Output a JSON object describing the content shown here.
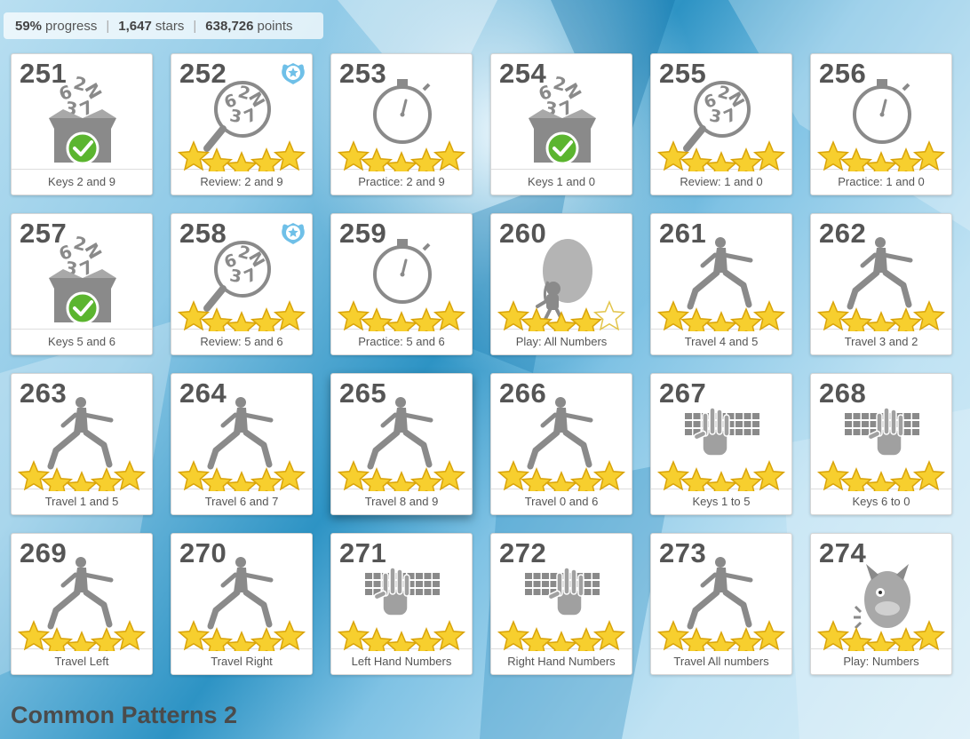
{
  "stats": {
    "progress_value": "59%",
    "progress_label": "progress",
    "stars_value": "1,647",
    "stars_label": "stars",
    "points_value": "638,726",
    "points_label": "points"
  },
  "tiles": [
    {
      "number": "251",
      "label": "Keys 2 and 9",
      "icon": "new-keys-box-icon",
      "stars": 0,
      "badge": false
    },
    {
      "number": "252",
      "label": "Review: 2 and 9",
      "icon": "magnifier-review-icon",
      "stars": 5,
      "badge": true
    },
    {
      "number": "253",
      "label": "Practice: 2 and 9",
      "icon": "stopwatch-icon",
      "stars": 5,
      "badge": false
    },
    {
      "number": "254",
      "label": "Keys 1 and 0",
      "icon": "new-keys-box-icon",
      "stars": 0,
      "badge": false
    },
    {
      "number": "255",
      "label": "Review: 1 and 0",
      "icon": "magnifier-review-icon",
      "stars": 5,
      "badge": false
    },
    {
      "number": "256",
      "label": "Practice: 1 and 0",
      "icon": "stopwatch-icon",
      "stars": 5,
      "badge": false
    },
    {
      "number": "257",
      "label": "Keys 5 and 6",
      "icon": "new-keys-box-icon",
      "stars": 0,
      "badge": false
    },
    {
      "number": "258",
      "label": "Review: 5 and 6",
      "icon": "magnifier-review-icon",
      "stars": 5,
      "badge": true
    },
    {
      "number": "259",
      "label": "Practice: 5 and 6",
      "icon": "stopwatch-icon",
      "stars": 5,
      "badge": false
    },
    {
      "number": "260",
      "label": "Play: All Numbers",
      "icon": "balloon-game-icon",
      "stars": 4,
      "badge": false
    },
    {
      "number": "261",
      "label": "Travel 4 and 5",
      "icon": "lunge-figure-icon",
      "stars": 5,
      "badge": false
    },
    {
      "number": "262",
      "label": "Travel 3 and 2",
      "icon": "lunge-figure-icon",
      "stars": 5,
      "badge": false
    },
    {
      "number": "263",
      "label": "Travel 1 and 5",
      "icon": "lunge-figure-icon",
      "stars": 5,
      "badge": false
    },
    {
      "number": "264",
      "label": "Travel 6 and 7",
      "icon": "lunge-figure-icon",
      "stars": 5,
      "badge": false
    },
    {
      "number": "265",
      "label": "Travel 8 and 9",
      "icon": "lunge-figure-icon",
      "stars": 5,
      "badge": false
    },
    {
      "number": "266",
      "label": "Travel 0 and 6",
      "icon": "lunge-figure-icon",
      "stars": 5,
      "badge": false
    },
    {
      "number": "267",
      "label": "Keys 1 to 5",
      "icon": "keyboard-left-hand-icon",
      "stars": 5,
      "badge": false
    },
    {
      "number": "268",
      "label": "Keys 6 to 0",
      "icon": "keyboard-right-hand-icon",
      "stars": 5,
      "badge": false
    },
    {
      "number": "269",
      "label": "Travel Left",
      "icon": "lunge-figure-icon",
      "stars": 5,
      "badge": false
    },
    {
      "number": "270",
      "label": "Travel Right",
      "icon": "lunge-figure-icon",
      "stars": 5,
      "badge": false
    },
    {
      "number": "271",
      "label": "Left Hand Numbers",
      "icon": "keyboard-left-hand-icon",
      "stars": 5,
      "badge": false
    },
    {
      "number": "272",
      "label": "Right Hand Numbers",
      "icon": "keyboard-right-hand-icon",
      "stars": 5,
      "badge": false
    },
    {
      "number": "273",
      "label": "Travel All numbers",
      "icon": "lunge-figure-icon",
      "stars": 5,
      "badge": false
    },
    {
      "number": "274",
      "label": "Play: Numbers",
      "icon": "monster-game-icon",
      "stars": 5,
      "badge": false
    }
  ],
  "section": {
    "title": "Common Patterns 2"
  },
  "colors": {
    "star_fill": "#f7cf2e",
    "star_outline": "#d9a40a",
    "check_green": "#5bb52f",
    "icon_gray": "#8a8a8a",
    "badge_blue": "#6fc0e8"
  }
}
